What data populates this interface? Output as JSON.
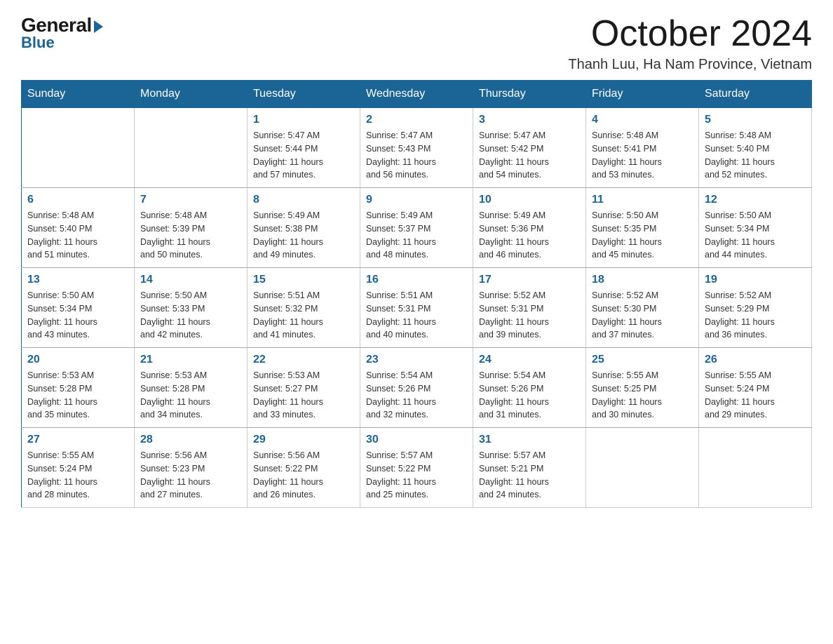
{
  "logo": {
    "general": "General",
    "arrow": "▶",
    "blue": "Blue"
  },
  "title": "October 2024",
  "location": "Thanh Luu, Ha Nam Province, Vietnam",
  "headers": [
    "Sunday",
    "Monday",
    "Tuesday",
    "Wednesday",
    "Thursday",
    "Friday",
    "Saturday"
  ],
  "weeks": [
    [
      {
        "day": "",
        "info": ""
      },
      {
        "day": "",
        "info": ""
      },
      {
        "day": "1",
        "info": "Sunrise: 5:47 AM\nSunset: 5:44 PM\nDaylight: 11 hours\nand 57 minutes."
      },
      {
        "day": "2",
        "info": "Sunrise: 5:47 AM\nSunset: 5:43 PM\nDaylight: 11 hours\nand 56 minutes."
      },
      {
        "day": "3",
        "info": "Sunrise: 5:47 AM\nSunset: 5:42 PM\nDaylight: 11 hours\nand 54 minutes."
      },
      {
        "day": "4",
        "info": "Sunrise: 5:48 AM\nSunset: 5:41 PM\nDaylight: 11 hours\nand 53 minutes."
      },
      {
        "day": "5",
        "info": "Sunrise: 5:48 AM\nSunset: 5:40 PM\nDaylight: 11 hours\nand 52 minutes."
      }
    ],
    [
      {
        "day": "6",
        "info": "Sunrise: 5:48 AM\nSunset: 5:40 PM\nDaylight: 11 hours\nand 51 minutes."
      },
      {
        "day": "7",
        "info": "Sunrise: 5:48 AM\nSunset: 5:39 PM\nDaylight: 11 hours\nand 50 minutes."
      },
      {
        "day": "8",
        "info": "Sunrise: 5:49 AM\nSunset: 5:38 PM\nDaylight: 11 hours\nand 49 minutes."
      },
      {
        "day": "9",
        "info": "Sunrise: 5:49 AM\nSunset: 5:37 PM\nDaylight: 11 hours\nand 48 minutes."
      },
      {
        "day": "10",
        "info": "Sunrise: 5:49 AM\nSunset: 5:36 PM\nDaylight: 11 hours\nand 46 minutes."
      },
      {
        "day": "11",
        "info": "Sunrise: 5:50 AM\nSunset: 5:35 PM\nDaylight: 11 hours\nand 45 minutes."
      },
      {
        "day": "12",
        "info": "Sunrise: 5:50 AM\nSunset: 5:34 PM\nDaylight: 11 hours\nand 44 minutes."
      }
    ],
    [
      {
        "day": "13",
        "info": "Sunrise: 5:50 AM\nSunset: 5:34 PM\nDaylight: 11 hours\nand 43 minutes."
      },
      {
        "day": "14",
        "info": "Sunrise: 5:50 AM\nSunset: 5:33 PM\nDaylight: 11 hours\nand 42 minutes."
      },
      {
        "day": "15",
        "info": "Sunrise: 5:51 AM\nSunset: 5:32 PM\nDaylight: 11 hours\nand 41 minutes."
      },
      {
        "day": "16",
        "info": "Sunrise: 5:51 AM\nSunset: 5:31 PM\nDaylight: 11 hours\nand 40 minutes."
      },
      {
        "day": "17",
        "info": "Sunrise: 5:52 AM\nSunset: 5:31 PM\nDaylight: 11 hours\nand 39 minutes."
      },
      {
        "day": "18",
        "info": "Sunrise: 5:52 AM\nSunset: 5:30 PM\nDaylight: 11 hours\nand 37 minutes."
      },
      {
        "day": "19",
        "info": "Sunrise: 5:52 AM\nSunset: 5:29 PM\nDaylight: 11 hours\nand 36 minutes."
      }
    ],
    [
      {
        "day": "20",
        "info": "Sunrise: 5:53 AM\nSunset: 5:28 PM\nDaylight: 11 hours\nand 35 minutes."
      },
      {
        "day": "21",
        "info": "Sunrise: 5:53 AM\nSunset: 5:28 PM\nDaylight: 11 hours\nand 34 minutes."
      },
      {
        "day": "22",
        "info": "Sunrise: 5:53 AM\nSunset: 5:27 PM\nDaylight: 11 hours\nand 33 minutes."
      },
      {
        "day": "23",
        "info": "Sunrise: 5:54 AM\nSunset: 5:26 PM\nDaylight: 11 hours\nand 32 minutes."
      },
      {
        "day": "24",
        "info": "Sunrise: 5:54 AM\nSunset: 5:26 PM\nDaylight: 11 hours\nand 31 minutes."
      },
      {
        "day": "25",
        "info": "Sunrise: 5:55 AM\nSunset: 5:25 PM\nDaylight: 11 hours\nand 30 minutes."
      },
      {
        "day": "26",
        "info": "Sunrise: 5:55 AM\nSunset: 5:24 PM\nDaylight: 11 hours\nand 29 minutes."
      }
    ],
    [
      {
        "day": "27",
        "info": "Sunrise: 5:55 AM\nSunset: 5:24 PM\nDaylight: 11 hours\nand 28 minutes."
      },
      {
        "day": "28",
        "info": "Sunrise: 5:56 AM\nSunset: 5:23 PM\nDaylight: 11 hours\nand 27 minutes."
      },
      {
        "day": "29",
        "info": "Sunrise: 5:56 AM\nSunset: 5:22 PM\nDaylight: 11 hours\nand 26 minutes."
      },
      {
        "day": "30",
        "info": "Sunrise: 5:57 AM\nSunset: 5:22 PM\nDaylight: 11 hours\nand 25 minutes."
      },
      {
        "day": "31",
        "info": "Sunrise: 5:57 AM\nSunset: 5:21 PM\nDaylight: 11 hours\nand 24 minutes."
      },
      {
        "day": "",
        "info": ""
      },
      {
        "day": "",
        "info": ""
      }
    ]
  ]
}
